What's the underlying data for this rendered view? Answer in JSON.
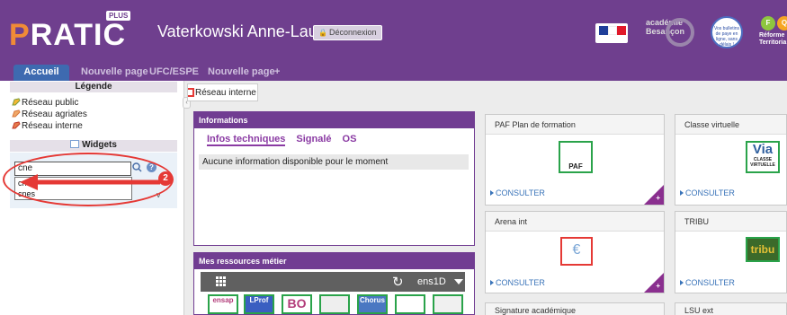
{
  "header": {
    "logo_text": "PRATIC",
    "logo_badge": "PLUS",
    "username": "Vaterkowski Anne-Laure",
    "logout_label": "Déconnexion",
    "academie_text": "académie Besançon",
    "round_logo_text": "Vos bulletins de paye en ligne, sans délais !",
    "faq_letters": [
      "F",
      "Q"
    ],
    "faq_text": "Réforme Territoria"
  },
  "tabs": [
    {
      "label": "Accueil",
      "active": true
    },
    {
      "label": "Nouvelle page"
    },
    {
      "label": "UFC/ESPE"
    },
    {
      "label": "Nouvelle page"
    },
    {
      "label": "+"
    }
  ],
  "sidebar": {
    "legend_title": "Légende",
    "legend_items": [
      "Réseau public",
      "Réseau agriates",
      "Réseau interne"
    ],
    "widgets_title": "Widgets",
    "search_value": "cne",
    "suggestions": [
      "cned",
      "cnes"
    ],
    "annotation_number": "2"
  },
  "tooltip": {
    "label": "Réseau interne"
  },
  "info_widget": {
    "title": "Informations",
    "tabs": [
      "Infos techniques",
      "Signalé",
      "OS"
    ],
    "message": "Aucune information disponible pour le moment"
  },
  "resources_widget": {
    "title": "Mes ressources métier",
    "selector": "ens1D",
    "tiles": [
      "ensap",
      "LProf",
      "BO",
      "",
      "Chorus",
      "",
      ""
    ]
  },
  "cards": [
    {
      "title": "PAF Plan de formation",
      "consult": "CONSULTER",
      "logo_text": "PAF"
    },
    {
      "title": "Classe virtuelle",
      "consult": "CONSULTER",
      "logo_text": "Via",
      "logo_sub": "CLASSE VIRTUELLE"
    },
    {
      "title": "Arena int",
      "consult": "CONSULTER",
      "logo_text": "€"
    },
    {
      "title": "TRIBU",
      "consult": "CONSULTER",
      "logo_text": "tribu"
    },
    {
      "title": "Signature académique"
    },
    {
      "title": "LSU ext"
    }
  ]
}
